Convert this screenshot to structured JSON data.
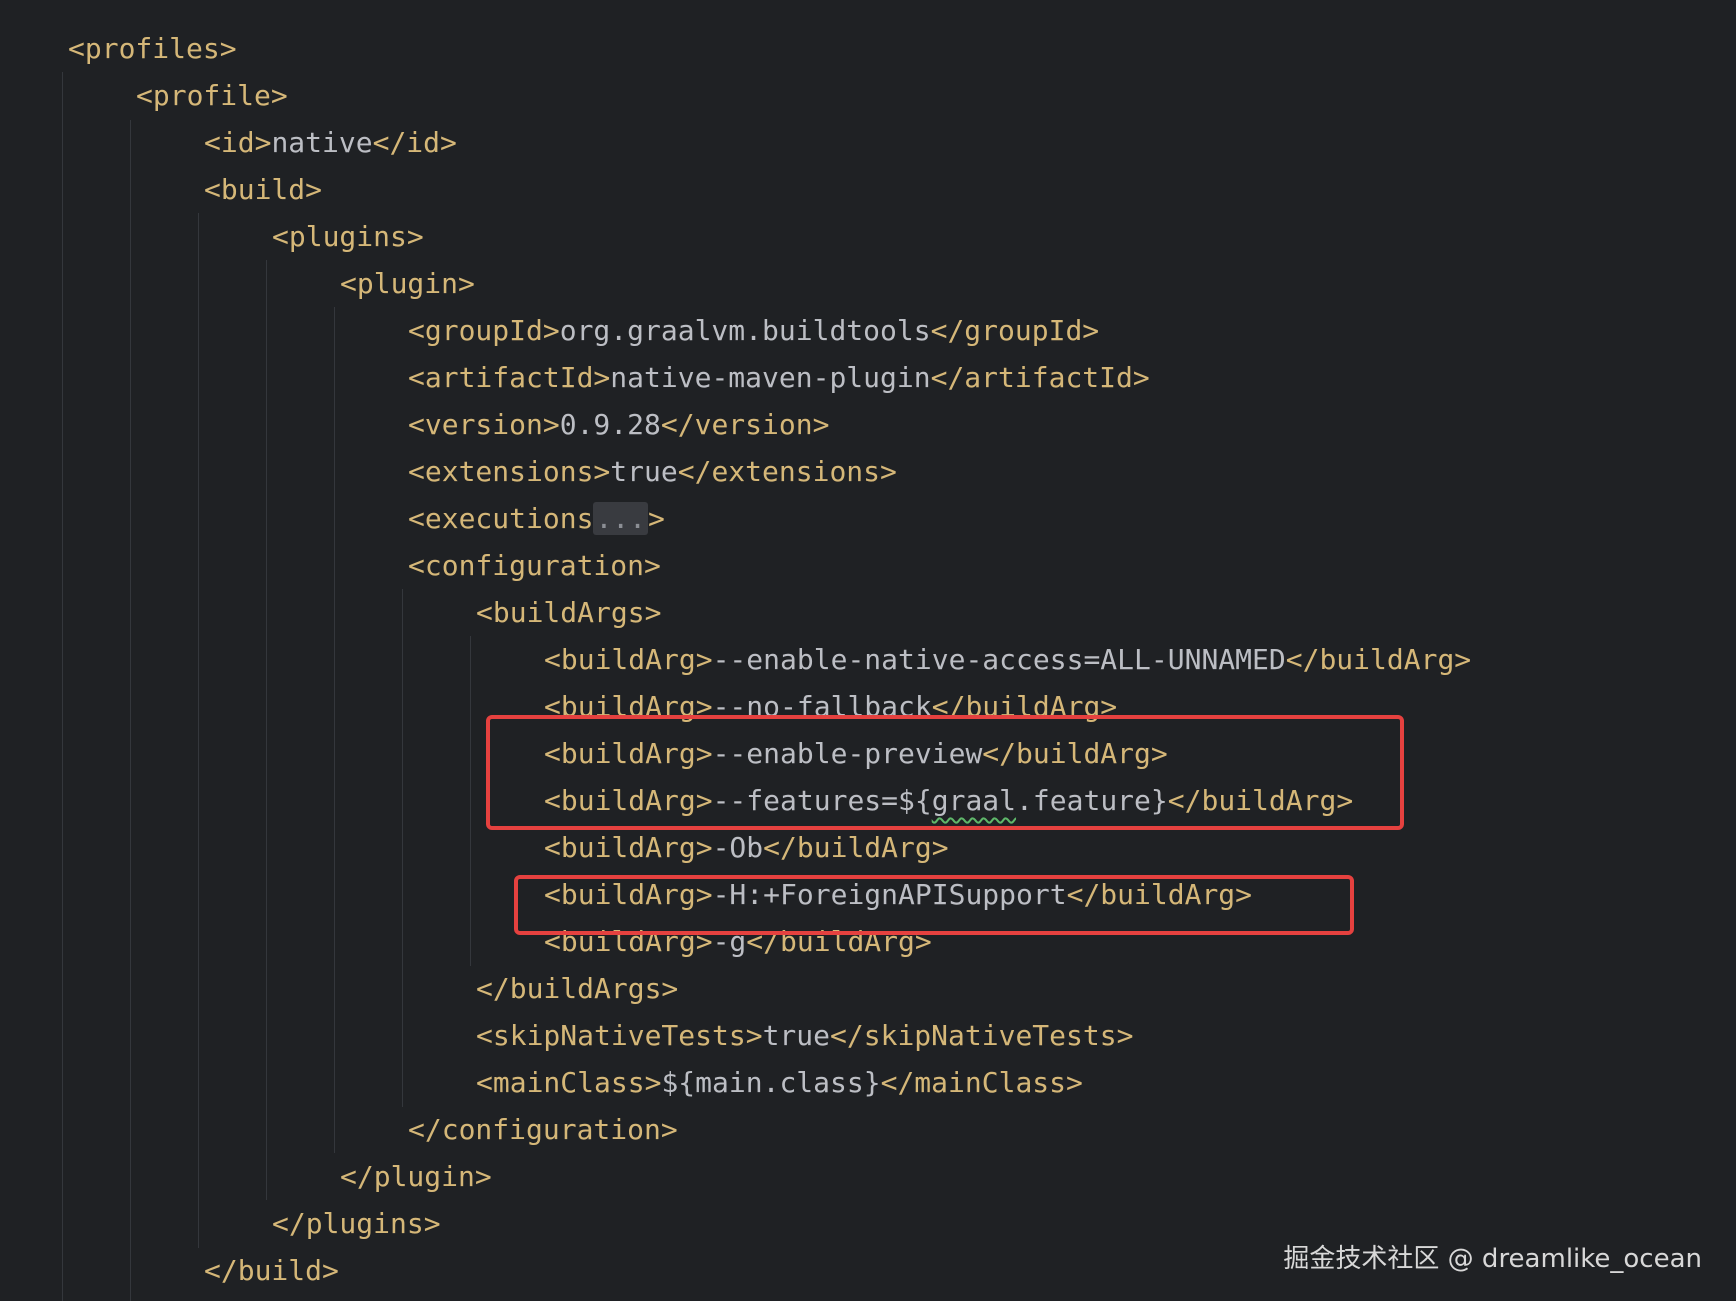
{
  "editor": {
    "language": "xml",
    "lines": [
      [
        {
          "t": "tag",
          "v": "<profiles>"
        }
      ],
      [
        {
          "t": "tag",
          "v": "<profile>"
        }
      ],
      [
        {
          "t": "tag",
          "v": "<id>"
        },
        {
          "t": "text",
          "v": "native"
        },
        {
          "t": "tag",
          "v": "</id>"
        }
      ],
      [
        {
          "t": "tag",
          "v": "<build>"
        }
      ],
      [
        {
          "t": "tag",
          "v": "<plugins>"
        }
      ],
      [
        {
          "t": "tag",
          "v": "<plugin>"
        }
      ],
      [
        {
          "t": "tag",
          "v": "<groupId>"
        },
        {
          "t": "text",
          "v": "org.graalvm.buildtools"
        },
        {
          "t": "tag",
          "v": "</groupId>"
        }
      ],
      [
        {
          "t": "tag",
          "v": "<artifactId>"
        },
        {
          "t": "text",
          "v": "native-maven-plugin"
        },
        {
          "t": "tag",
          "v": "</artifactId>"
        }
      ],
      [
        {
          "t": "tag",
          "v": "<version>"
        },
        {
          "t": "text",
          "v": "0.9.28"
        },
        {
          "t": "tag",
          "v": "</version>"
        }
      ],
      [
        {
          "t": "tag",
          "v": "<extensions>"
        },
        {
          "t": "text",
          "v": "true"
        },
        {
          "t": "tag",
          "v": "</extensions>"
        }
      ],
      [
        {
          "t": "tag",
          "v": "<executions"
        },
        {
          "t": "fold",
          "v": "..."
        },
        {
          "t": "tag",
          "v": ">"
        }
      ],
      [
        {
          "t": "tag",
          "v": "<configuration>"
        }
      ],
      [
        {
          "t": "tag",
          "v": "<buildArgs>"
        }
      ],
      [
        {
          "t": "tag",
          "v": "<buildArg>"
        },
        {
          "t": "text",
          "v": "--enable-native-access=ALL-UNNAMED"
        },
        {
          "t": "tag",
          "v": "</buildArg>"
        }
      ],
      [
        {
          "t": "tag",
          "v": "<buildArg>"
        },
        {
          "t": "text",
          "v": "--no-fallback"
        },
        {
          "t": "tag",
          "v": "</buildArg>"
        }
      ],
      [
        {
          "t": "tag",
          "v": "<buildArg>"
        },
        {
          "t": "text",
          "v": "--enable-preview"
        },
        {
          "t": "tag",
          "v": "</buildArg>"
        }
      ],
      [
        {
          "t": "tag",
          "v": "<buildArg>"
        },
        {
          "t": "text",
          "v": "--features=${"
        },
        {
          "t": "squiggle",
          "v": "graal"
        },
        {
          "t": "text",
          "v": ".feature}"
        },
        {
          "t": "tag",
          "v": "</buildArg>"
        }
      ],
      [
        {
          "t": "tag",
          "v": "<buildArg>"
        },
        {
          "t": "text",
          "v": "-Ob"
        },
        {
          "t": "tag",
          "v": "</buildArg>"
        }
      ],
      [
        {
          "t": "tag",
          "v": "<buildArg>"
        },
        {
          "t": "text",
          "v": "-H:+ForeignAPISupport"
        },
        {
          "t": "tag",
          "v": "</buildArg>"
        }
      ],
      [
        {
          "t": "tag",
          "v": "<buildArg>"
        },
        {
          "t": "text",
          "v": "-g"
        },
        {
          "t": "tag",
          "v": "</buildArg>"
        }
      ],
      [
        {
          "t": "tag",
          "v": "</buildArgs>"
        }
      ],
      [
        {
          "t": "tag",
          "v": "<skipNativeTests>"
        },
        {
          "t": "text",
          "v": "true"
        },
        {
          "t": "tag",
          "v": "</skipNativeTests>"
        }
      ],
      [
        {
          "t": "tag",
          "v": "<mainClass>"
        },
        {
          "t": "text",
          "v": "${main.class}"
        },
        {
          "t": "tag",
          "v": "</mainClass>"
        }
      ],
      [
        {
          "t": "tag",
          "v": "</configuration>"
        }
      ],
      [
        {
          "t": "tag",
          "v": "</plugin>"
        }
      ],
      [
        {
          "t": "tag",
          "v": "</plugins>"
        }
      ],
      [
        {
          "t": "tag",
          "v": "</build>"
        }
      ]
    ]
  },
  "annotations": {
    "box_color": "#e5413f",
    "highlighted_groups": [
      "buildArg --enable-preview / --features",
      "buildArg -H:+ForeignAPISupport"
    ]
  },
  "watermark": "掘金技术社区 @ dreamlike_ocean",
  "colors": {
    "background": "#1f2124",
    "tag": "#d5b778",
    "text": "#bcbec4",
    "guide": "#34373c",
    "squiggle": "#5fb86a"
  }
}
